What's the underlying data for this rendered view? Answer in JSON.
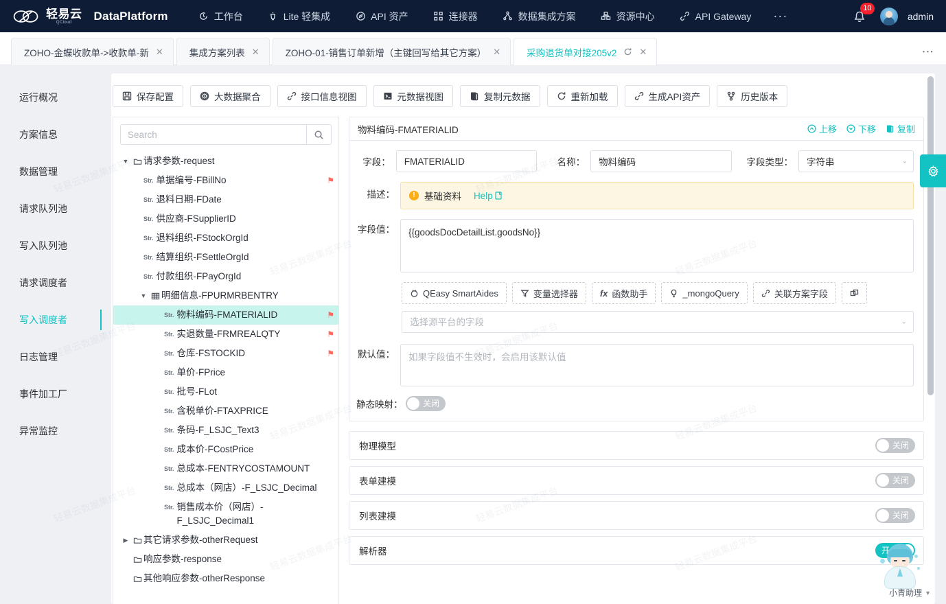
{
  "topnav": {
    "brand_cn": "轻易云",
    "brand_sub": "QCloud",
    "brand_en": "DataPlatform",
    "items": [
      {
        "label": "工作台",
        "icon": "clock-icon"
      },
      {
        "label": "Lite 轻集成",
        "icon": "lantern-icon"
      },
      {
        "label": "API 资产",
        "icon": "compass-icon"
      },
      {
        "label": "连接器",
        "icon": "nodes-icon"
      },
      {
        "label": "数据集成方案",
        "icon": "sitemap-icon"
      },
      {
        "label": "资源中心",
        "icon": "blocks-icon"
      },
      {
        "label": "API Gateway",
        "icon": "link-icon"
      }
    ],
    "more": "···",
    "notifications": "10",
    "user": "admin"
  },
  "tabs": [
    {
      "label": "ZOHO-金蝶收款单->收款单-新",
      "active": false,
      "reload": false
    },
    {
      "label": "集成方案列表",
      "active": false,
      "reload": false
    },
    {
      "label": "ZOHO-01-销售订单新增（主键回写给其它方案）",
      "active": false,
      "reload": false
    },
    {
      "label": "采购退货单对接205v2",
      "active": true,
      "reload": true
    }
  ],
  "tabbar": {
    "more": "⋮",
    "close": "✕"
  },
  "sidemenu": {
    "items": [
      {
        "label": "运行概况",
        "active": false
      },
      {
        "label": "方案信息",
        "active": false
      },
      {
        "label": "数据管理",
        "active": false
      },
      {
        "label": "请求队列池",
        "active": false
      },
      {
        "label": "写入队列池",
        "active": false
      },
      {
        "label": "请求调度者",
        "active": false
      },
      {
        "label": "写入调度者",
        "active": true
      },
      {
        "label": "日志管理",
        "active": false
      },
      {
        "label": "事件加工厂",
        "active": false
      },
      {
        "label": "异常监控",
        "active": false
      }
    ]
  },
  "toolbar": {
    "buttons": [
      {
        "label": "保存配置",
        "icon": "save-icon"
      },
      {
        "label": "大数据聚合",
        "icon": "aggregate-icon"
      },
      {
        "label": "接口信息视图",
        "icon": "link-icon"
      },
      {
        "label": "元数据视图",
        "icon": "terminal-icon"
      },
      {
        "label": "复制元数据",
        "icon": "copy-icon"
      },
      {
        "label": "重新加载",
        "icon": "reload-icon"
      },
      {
        "label": "生成API资产",
        "icon": "link-icon"
      },
      {
        "label": "历史版本",
        "icon": "branch-icon"
      }
    ]
  },
  "tree": {
    "search_placeholder": "Search",
    "search_value": "",
    "search_icon": "search-icon",
    "nodes": [
      {
        "level": 1,
        "arrow": "▼",
        "icon": "folder-icon",
        "label": "请求参数-request",
        "flag": false,
        "selected": false
      },
      {
        "level": 2,
        "arrow": "",
        "icon": "str",
        "label": "单据编号-FBillNo",
        "flag": true,
        "selected": false
      },
      {
        "level": 2,
        "arrow": "",
        "icon": "str",
        "label": "退料日期-FDate",
        "flag": false,
        "selected": false
      },
      {
        "level": 2,
        "arrow": "",
        "icon": "str",
        "label": "供应商-FSupplierID",
        "flag": false,
        "selected": false
      },
      {
        "level": 2,
        "arrow": "",
        "icon": "str",
        "label": "退料组织-FStockOrgId",
        "flag": false,
        "selected": false
      },
      {
        "level": 2,
        "arrow": "",
        "icon": "str",
        "label": "结算组织-FSettleOrgId",
        "flag": false,
        "selected": false
      },
      {
        "level": 2,
        "arrow": "",
        "icon": "str",
        "label": "付款组织-FPayOrgId",
        "flag": false,
        "selected": false
      },
      {
        "level": 3,
        "arrow": "▼",
        "icon": "table-icon",
        "label": "明细信息-FPURMRBENTRY",
        "flag": false,
        "selected": false
      },
      {
        "level": 4,
        "arrow": "",
        "icon": "str",
        "label": "物料编码-FMATERIALID",
        "flag": true,
        "selected": true
      },
      {
        "level": 4,
        "arrow": "",
        "icon": "str",
        "label": "实退数量-FRMREALQTY",
        "flag": true,
        "selected": false
      },
      {
        "level": 4,
        "arrow": "",
        "icon": "str",
        "label": "仓库-FSTOCKID",
        "flag": true,
        "selected": false
      },
      {
        "level": 4,
        "arrow": "",
        "icon": "str",
        "label": "单价-FPrice",
        "flag": false,
        "selected": false
      },
      {
        "level": 4,
        "arrow": "",
        "icon": "str",
        "label": "批号-FLot",
        "flag": false,
        "selected": false
      },
      {
        "level": 4,
        "arrow": "",
        "icon": "str",
        "label": "含税单价-FTAXPRICE",
        "flag": false,
        "selected": false
      },
      {
        "level": 4,
        "arrow": "",
        "icon": "str",
        "label": "条码-F_LSJC_Text3",
        "flag": false,
        "selected": false
      },
      {
        "level": 4,
        "arrow": "",
        "icon": "str",
        "label": "成本价-FCostPrice",
        "flag": false,
        "selected": false
      },
      {
        "level": 4,
        "arrow": "",
        "icon": "str",
        "label": "总成本-FENTRYCOSTAMOUNT",
        "flag": false,
        "selected": false
      },
      {
        "level": 4,
        "arrow": "",
        "icon": "str",
        "label": "总成本（网店）-F_LSJC_Decimal",
        "flag": false,
        "selected": false
      },
      {
        "level": 4,
        "arrow": "",
        "icon": "str",
        "label": "销售成本价（网店）-F_LSJC_Decimal1",
        "flag": false,
        "selected": false
      },
      {
        "level": 1,
        "arrow": "▶",
        "icon": "folder-icon",
        "label": "其它请求参数-otherRequest",
        "flag": false,
        "selected": false
      },
      {
        "level": 1,
        "arrow": "",
        "icon": "folder-icon",
        "label": "响应参数-response",
        "flag": false,
        "selected": false
      },
      {
        "level": 1,
        "arrow": "",
        "icon": "folder-icon",
        "label": "其他响应参数-otherResponse",
        "flag": false,
        "selected": false
      }
    ]
  },
  "detail": {
    "title": "物料编码-FMATERIALID",
    "actions": [
      {
        "label": "上移",
        "icon": "arrow-up-circle-icon"
      },
      {
        "label": "下移",
        "icon": "arrow-down-circle-icon"
      },
      {
        "label": "复制",
        "icon": "copy-icon"
      }
    ],
    "field_label": "字段：",
    "field_value": "FMATERIALID",
    "name_label": "名称：",
    "name_value": "物料编码",
    "type_label": "字段类型：",
    "type_value": "字符串",
    "desc_label": "描述：",
    "desc_text": "基础资料",
    "desc_help": "Help",
    "fieldvalue_label": "字段值：",
    "fieldvalue_text": "{{goodsDocDetailList.goodsNo}}",
    "chips": [
      {
        "label": "QEasy SmartAides",
        "icon": "brain-icon"
      },
      {
        "label": "变量选择器",
        "icon": "filter-icon"
      },
      {
        "label": "函数助手",
        "icon": "fx-icon"
      },
      {
        "label": "_mongoQuery",
        "icon": "bulb-icon"
      },
      {
        "label": "关联方案字段",
        "icon": "link-icon"
      },
      {
        "label": "",
        "icon": "grid-icon"
      }
    ],
    "source_placeholder": "选择源平台的字段",
    "source_value": "",
    "default_label": "默认值：",
    "default_placeholder": "如果字段值不生效时，会启用该默认值",
    "default_value": "",
    "static_map_label": "静态映射：",
    "static_map_state": "关闭",
    "panels": [
      {
        "label": "物理模型",
        "state": "关闭",
        "on": false
      },
      {
        "label": "表单建模",
        "state": "关闭",
        "on": false
      },
      {
        "label": "列表建模",
        "state": "关闭",
        "on": false
      },
      {
        "label": "解析器",
        "state": "开启",
        "on": true
      }
    ]
  },
  "gear_button": {
    "icon": "gear-icon"
  },
  "assistant": {
    "label": "小青助理",
    "caret": "▼"
  },
  "watermark": {
    "text": "轻易云数据集成平台"
  },
  "colors": {
    "accent": "#13c2c2",
    "navbar": "#0e1c36",
    "badge": "#f5222d",
    "flag": "#ff6b5e",
    "selected_row": "#c8f4ee"
  }
}
